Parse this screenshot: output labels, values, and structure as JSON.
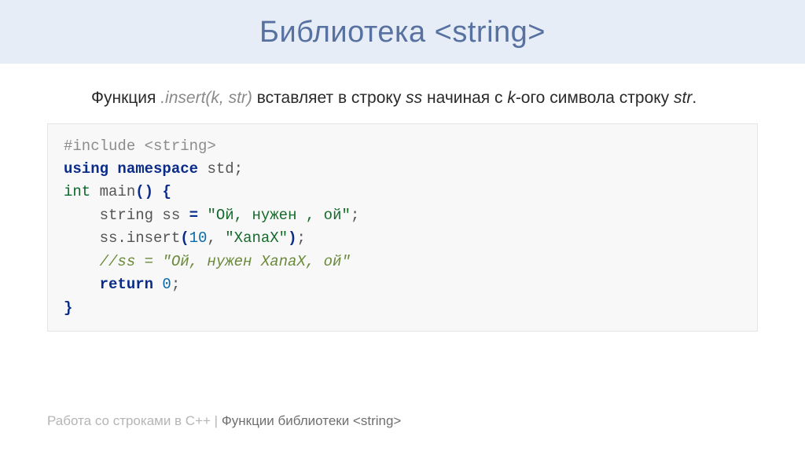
{
  "title": "Библиотека <string>",
  "description": {
    "prefix": "Функция ",
    "func": ".insert(k, str)",
    "part2": " вставляет в строку ",
    "ss": "ss",
    "part3": " начиная с ",
    "k": "k",
    "part4": "-ого символа строку ",
    "str": "str",
    "tail": "."
  },
  "code": {
    "l1": "#include <string>",
    "l2_using": "using",
    "l2_namespace": "namespace",
    "l2_std": " std;",
    "l3_int": "int",
    "l3_main": " main",
    "l3_paren": "()",
    "l3_brace": " {",
    "l4_prefix": "    string ss ",
    "l4_eq": "=",
    "l4_str": " \"Ой, нужен , ой\"",
    "l4_end": ";",
    "l5_prefix": "    ss.insert",
    "l5_paren_open": "(",
    "l5_num": "10",
    "l5_sep": ", ",
    "l5_str": "\"XanaX\"",
    "l5_paren_close": ")",
    "l5_end": ";",
    "l6": "    //ss = \"Ой, нужен XanaX, ой\"",
    "l7_ret": "    return",
    "l7_val": " 0",
    "l7_end": ";",
    "l8": "}"
  },
  "footer": {
    "left": "Работа со строками в С++ | ",
    "right": "Функции библиотеки <string>"
  }
}
